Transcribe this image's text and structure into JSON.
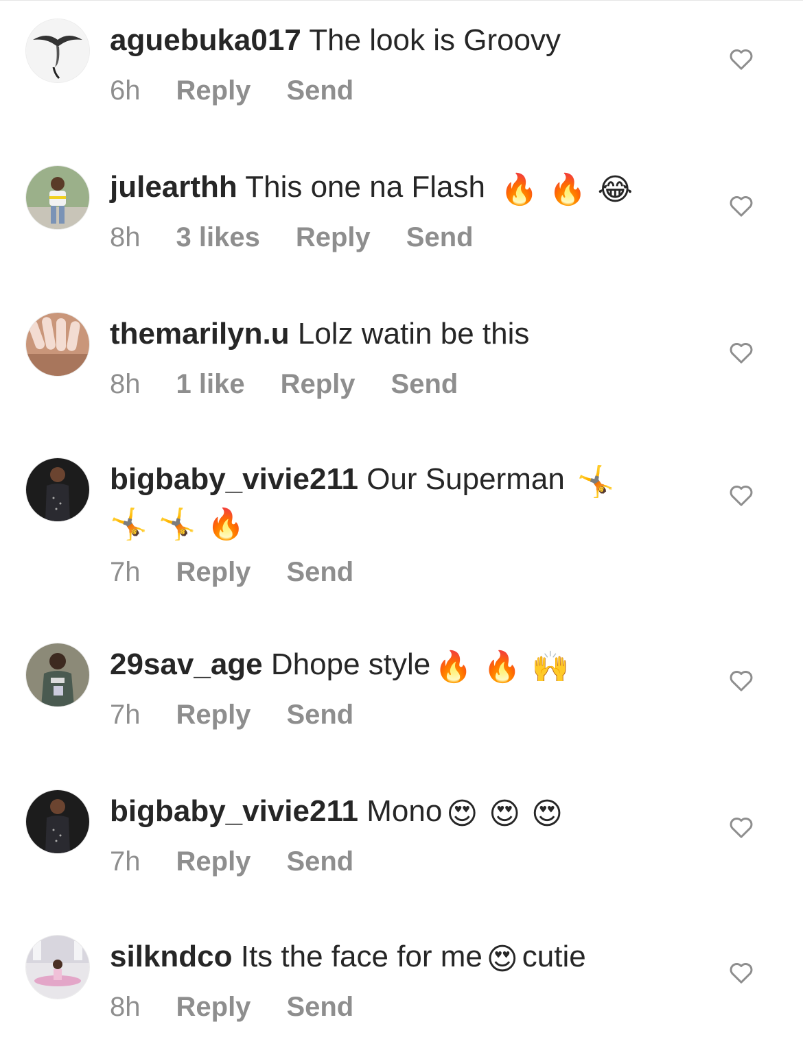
{
  "comments": [
    {
      "username": "aguebuka017",
      "text": "The look is Groovy",
      "emojis": [],
      "time": "6h",
      "likes": "",
      "reply": "Reply",
      "send": "Send",
      "avatar_icon": "eagle-avatar-icon"
    },
    {
      "username": "julearthh",
      "text": "This one na Flash",
      "emojis": [
        "🔥",
        "🔥",
        "😂"
      ],
      "time": "8h",
      "likes": "3 likes",
      "reply": "Reply",
      "send": "Send",
      "avatar_icon": "person-avatar-icon"
    },
    {
      "username": "themarilyn.u",
      "text": "Lolz watin be this",
      "emojis": [],
      "time": "8h",
      "likes": "1 like",
      "reply": "Reply",
      "send": "Send",
      "avatar_icon": "nails-avatar-icon"
    },
    {
      "username": "bigbaby_vivie211",
      "text": "Our Superman",
      "emojis": [
        "🤸",
        "🤸",
        "🤸",
        "🔥"
      ],
      "time": "7h",
      "likes": "",
      "reply": "Reply",
      "send": "Send",
      "avatar_icon": "person-avatar-icon"
    },
    {
      "username": "29sav_age",
      "text": "Dhope style",
      "emojis": [
        "🔥",
        "🔥",
        "🙌"
      ],
      "time": "7h",
      "likes": "",
      "reply": "Reply",
      "send": "Send",
      "avatar_icon": "person-avatar-icon"
    },
    {
      "username": "bigbaby_vivie211",
      "text": "Mono",
      "emojis": [
        "😍",
        "😍",
        "😍"
      ],
      "time": "7h",
      "likes": "",
      "reply": "Reply",
      "send": "Send",
      "avatar_icon": "person-avatar-icon"
    },
    {
      "username": "silkndco",
      "text": "Its the face for me",
      "emojis": [
        "😍"
      ],
      "text_after": "cutie",
      "time": "8h",
      "likes": "",
      "reply": "Reply",
      "send": "Send",
      "avatar_icon": "room-avatar-icon"
    }
  ],
  "colors": {
    "text": "#262626",
    "meta": "#8e8e8e",
    "heart_outline": "#8e8e8e"
  },
  "icons": {
    "like": "heart-outline-icon"
  }
}
